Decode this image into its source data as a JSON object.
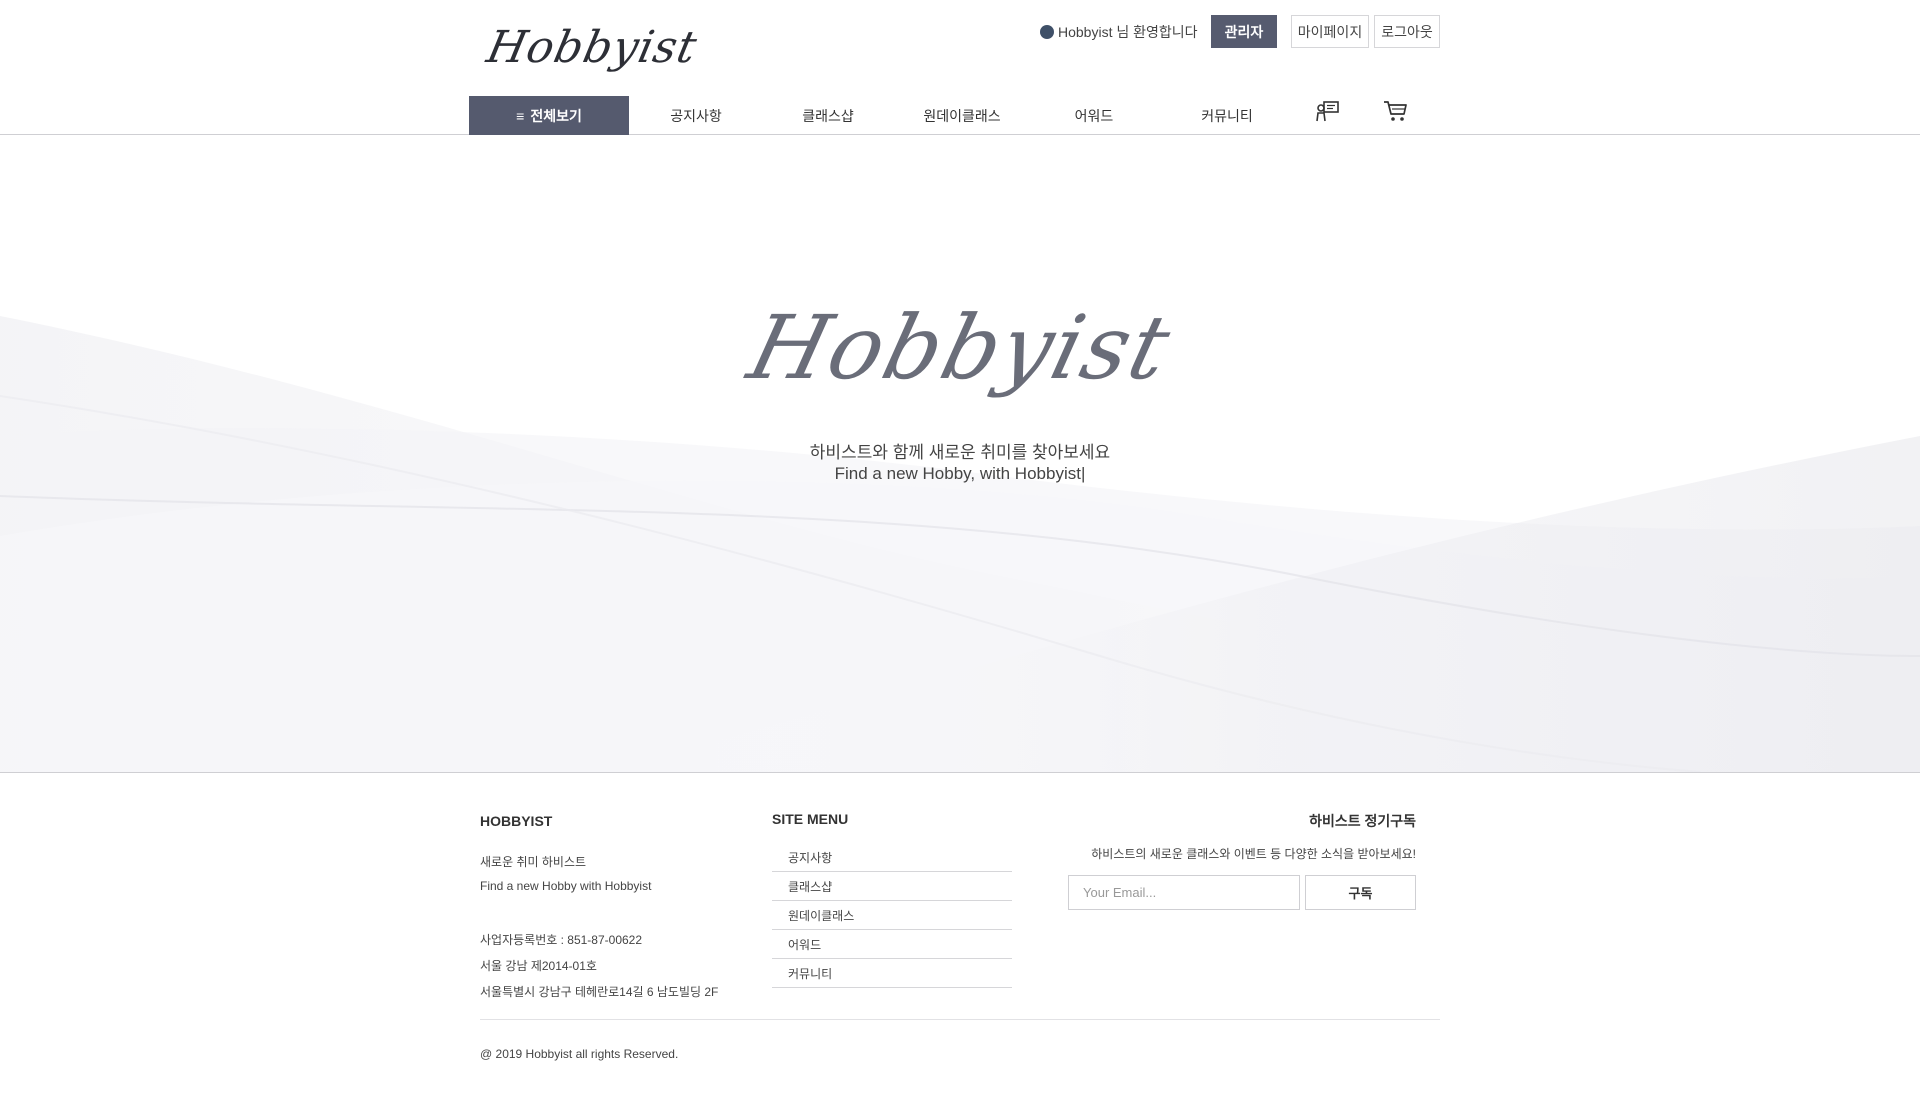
{
  "header": {
    "logo": "Hobbyist",
    "welcome_user": "Hobbyist",
    "welcome_suffix": " 님 환영합니다",
    "admin_label": "관리자",
    "mypage_label": "마이페이지",
    "logout_label": "로그아웃"
  },
  "nav": {
    "all_label": "전체보기",
    "items": [
      "공지사항",
      "클래스샵",
      "원데이클래스",
      "어워드",
      "커뮤니티"
    ],
    "icons": [
      "chat-icon",
      "cart-icon"
    ]
  },
  "hero": {
    "logo": "Hobbyist",
    "tagline_ko": "하비스트와 함께 새로운 취미를 찾아보세요",
    "tagline_en": "Find a new Hobby, with Hobbyist|"
  },
  "footer": {
    "company": {
      "title": "HOBBYIST",
      "line1": "새로운 취미 하비스트",
      "line2": "Find a new Hobby with Hobbyist",
      "biz_no": "사업자등록번호 : 851-87-00622",
      "reg_no": "서울 강남 제2014-01호",
      "address": "서울특별시 강남구 테헤란로14길 6 남도빌딩 2F"
    },
    "site_menu": {
      "title": "SITE MENU",
      "items": [
        "공지사항",
        "클래스샵",
        "원데이클래스",
        "어워드",
        "커뮤니티"
      ]
    },
    "subscribe": {
      "title": "하비스트 정기구독",
      "desc": "하비스트의 새로운 클래스와 이벤트 등 다양한 소식을 받아보세요!",
      "placeholder": "Your Email...",
      "button": "구독"
    },
    "copyright": "@ 2019 Hobbyist all rights Reserved."
  },
  "colors": {
    "accent": "#555a6e",
    "border": "#cfcfd3"
  }
}
